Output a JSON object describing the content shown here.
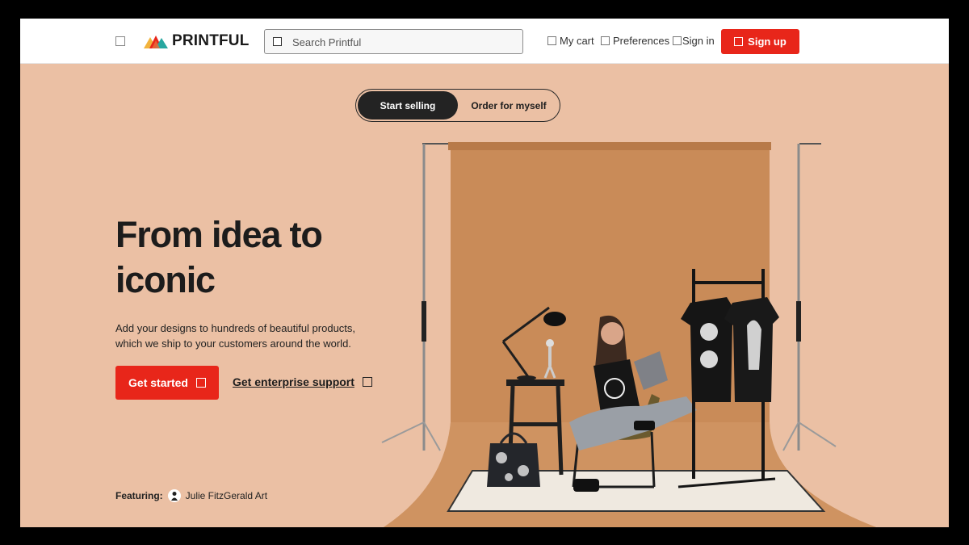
{
  "header": {
    "logo_text": "PRINTFUL",
    "search_placeholder": "Search Printful",
    "nav": {
      "cart": "My cart",
      "preferences": "Preferences",
      "signin": "Sign in",
      "signup": "Sign up"
    }
  },
  "toggle": {
    "active": "Start selling",
    "inactive": "Order for myself"
  },
  "hero": {
    "headline_line1": "From idea to",
    "headline_line2": "iconic",
    "subtext": "Add your designs to hundreds of beautiful products, which we ship to your customers around the world.",
    "cta_primary": "Get started",
    "cta_secondary": "Get enterprise support",
    "featuring_label": "Featuring:",
    "featuring_name": "Julie FitzGerald Art"
  },
  "colors": {
    "accent": "#e8261a",
    "hero_bg": "#ebc0a4",
    "backdrop": "#c98b58",
    "dark": "#232323"
  }
}
